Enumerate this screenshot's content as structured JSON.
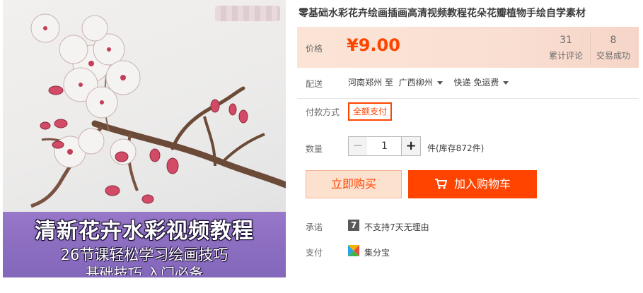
{
  "product": {
    "title": "零基础水彩花卉绘画插画高清视频教程花朵花瓣植物手绘自学素材",
    "image": {
      "banner_title": "清新花卉水彩视频教程",
      "banner_subtitle": "26节课轻松学习绘画技巧",
      "banner_subtitle2": "基础技巧 入门必备"
    }
  },
  "price": {
    "label": "价格",
    "value": "¥9.00",
    "reviews_count": "31",
    "reviews_label": "累计评论",
    "sales_count": "8",
    "sales_label": "交易成功"
  },
  "delivery": {
    "label": "配送",
    "from": "河南郑州 至",
    "to": "广西柳州",
    "method": "快递 免运费"
  },
  "payment_method": {
    "label": "付款方式",
    "option": "全额支付"
  },
  "quantity": {
    "label": "数量",
    "minus": "−",
    "value": "1",
    "plus": "+",
    "stock": "件(库存872件)"
  },
  "actions": {
    "buy_now": "立即购买",
    "add_to_cart": "加入购物车"
  },
  "promise": {
    "label": "承诺",
    "icon_text": "7",
    "text": "不支持7天无理由"
  },
  "payment": {
    "label": "支付",
    "text": "集分宝"
  },
  "colors": {
    "accent": "#ff4400",
    "price_bg": "#fbe4d6",
    "buy_now_bg": "#fde1cf",
    "banner": "#8e6fc2"
  },
  "icons": [
    "cart-icon",
    "caret-down-icon",
    "promise-7-icon",
    "jifenbao-icon"
  ]
}
